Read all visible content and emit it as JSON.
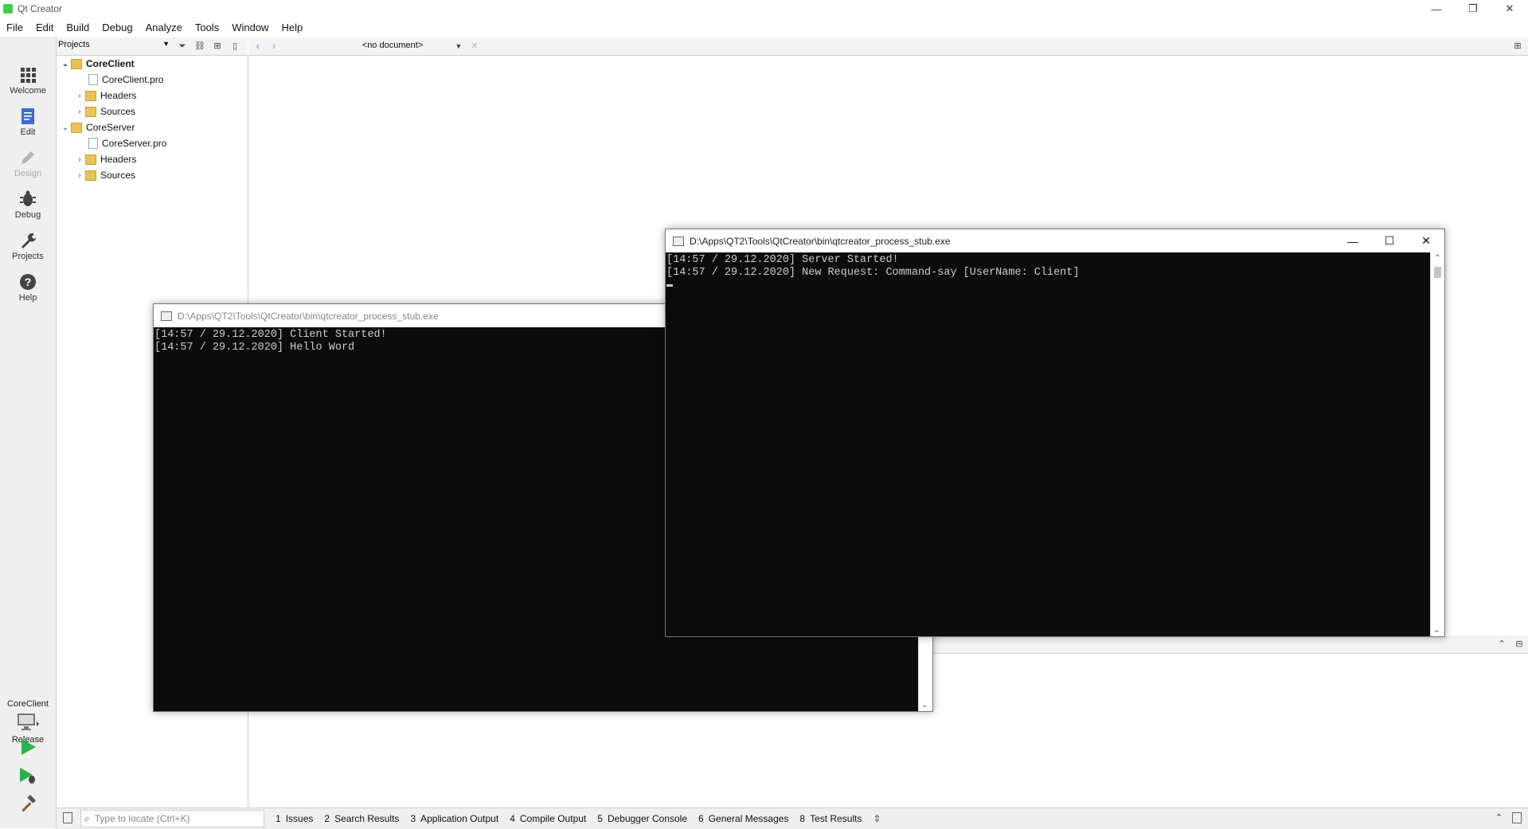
{
  "window": {
    "title": "Qt Creator",
    "minimize_glyph": "—",
    "restore_glyph": "❐",
    "close_glyph": "✕"
  },
  "menubar": [
    "File",
    "Edit",
    "Build",
    "Debug",
    "Analyze",
    "Tools",
    "Window",
    "Help"
  ],
  "modes": [
    {
      "label": "Welcome",
      "icon": "grid-icon"
    },
    {
      "label": "Edit",
      "icon": "document-icon"
    },
    {
      "label": "Design",
      "icon": "pencil-icon"
    },
    {
      "label": "Debug",
      "icon": "bug-icon"
    },
    {
      "label": "Projects",
      "icon": "wrench-icon"
    },
    {
      "label": "Help",
      "icon": "question-icon"
    }
  ],
  "projects_panel": {
    "combo_label": "Projects",
    "tree": [
      {
        "label": "CoreClient",
        "type": "project"
      },
      {
        "label": "CoreClient.pro",
        "type": "file"
      },
      {
        "label": "Headers",
        "type": "folder"
      },
      {
        "label": "Sources",
        "type": "folder"
      },
      {
        "label": "CoreServer",
        "type": "project"
      },
      {
        "label": "CoreServer.pro",
        "type": "file"
      },
      {
        "label": "Headers",
        "type": "folder"
      },
      {
        "label": "Sources",
        "type": "folder"
      }
    ]
  },
  "editor_toolbar": {
    "document": "<no document>"
  },
  "kit": {
    "project": "CoreClient",
    "build": "Release"
  },
  "statusbar": {
    "locator_placeholder": "Type to locate (Ctrl+K)",
    "tabs": [
      {
        "num": "1",
        "label": "Issues"
      },
      {
        "num": "2",
        "label": "Search Results"
      },
      {
        "num": "3",
        "label": "Application Output"
      },
      {
        "num": "4",
        "label": "Compile Output"
      },
      {
        "num": "5",
        "label": "Debugger Console"
      },
      {
        "num": "6",
        "label": "General Messages"
      },
      {
        "num": "8",
        "label": "Test Results"
      }
    ]
  },
  "client_console": {
    "title": "D:\\Apps\\QT2\\Tools\\QtCreator\\bin\\qtcreator_process_stub.exe",
    "lines": [
      "[14:57 / 29.12.2020] Client Started!",
      "[14:57 / 29.12.2020] Hello Word"
    ]
  },
  "server_console": {
    "title": "D:\\Apps\\QT2\\Tools\\QtCreator\\bin\\qtcreator_process_stub.exe",
    "lines": [
      "[14:57 / 29.12.2020] Server Started!",
      "[14:57 / 29.12.2020] New Request: Command-say [UserName: Client]"
    ]
  }
}
